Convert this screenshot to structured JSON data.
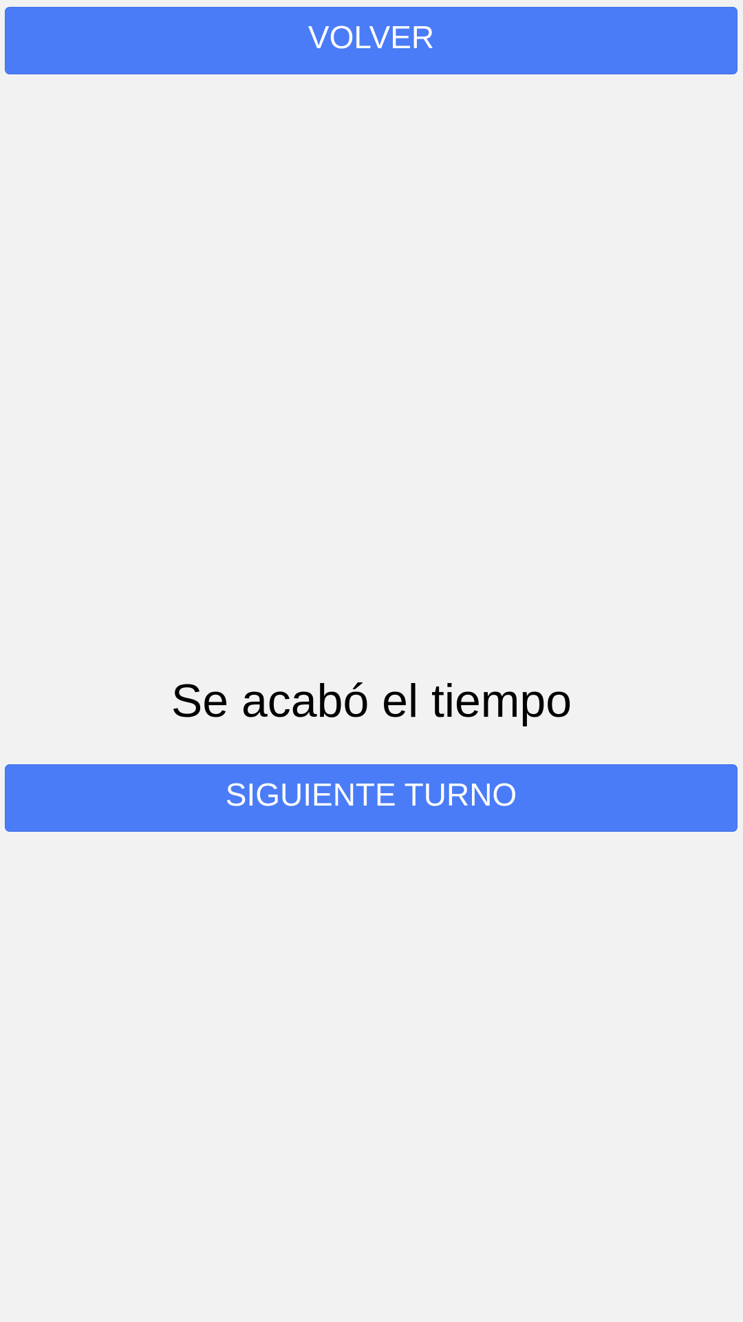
{
  "header": {
    "back_label": "VOLVER"
  },
  "main": {
    "message": "Se acabó el tiempo",
    "next_turn_label": "SIGUIENTE TURNO"
  },
  "colors": {
    "background": "#f2f2f2",
    "button_accent": "#4a7cf8",
    "button_text": "#ffffff",
    "message_text": "#000000"
  }
}
